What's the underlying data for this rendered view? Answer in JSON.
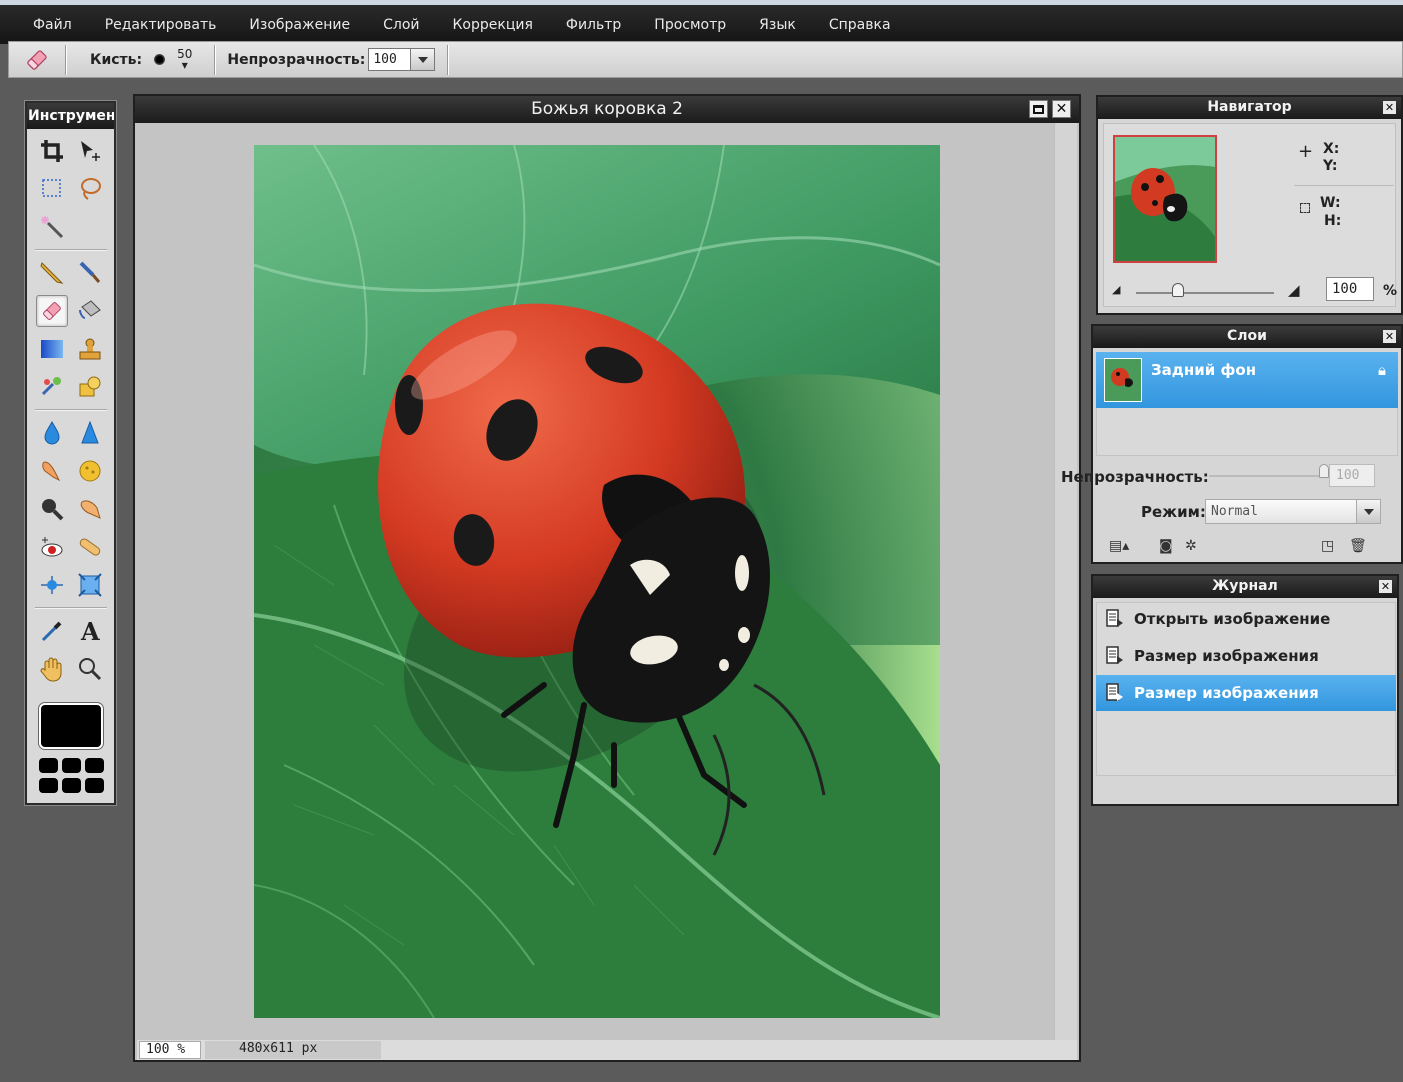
{
  "menu": {
    "items": [
      "Файл",
      "Редактировать",
      "Изображение",
      "Слой",
      "Коррекция",
      "Фильтр",
      "Просмотр",
      "Язык",
      "Справка"
    ]
  },
  "options_bar": {
    "brush_label": "Кисть:",
    "brush_size": "50",
    "opacity_label": "Непрозрачность:",
    "opacity_value": "100"
  },
  "tools_panel": {
    "title": "Инструмент",
    "selected_tool": "eraser-tool"
  },
  "document": {
    "title": "Божья коровка 2",
    "zoom": "100 %",
    "dimensions": "480x611 px"
  },
  "navigator": {
    "title": "Навигатор",
    "x_label": "X:",
    "y_label": "Y:",
    "w_label": "W:",
    "h_label": "H:",
    "zoom_value": "100",
    "zoom_unit": "%"
  },
  "layers": {
    "title": "Слои",
    "layer_name": "Задний фон",
    "opacity_label": "Непрозрачность:",
    "opacity_value": "100",
    "mode_label": "Режим:",
    "mode_value": "Normal"
  },
  "history": {
    "title": "Журнал",
    "items": [
      "Открыть изображение",
      "Размер изображения",
      "Размер изображения"
    ],
    "active_index": 2
  },
  "colors": {
    "accent": "#3a9ee6",
    "foreground": "#000000"
  }
}
